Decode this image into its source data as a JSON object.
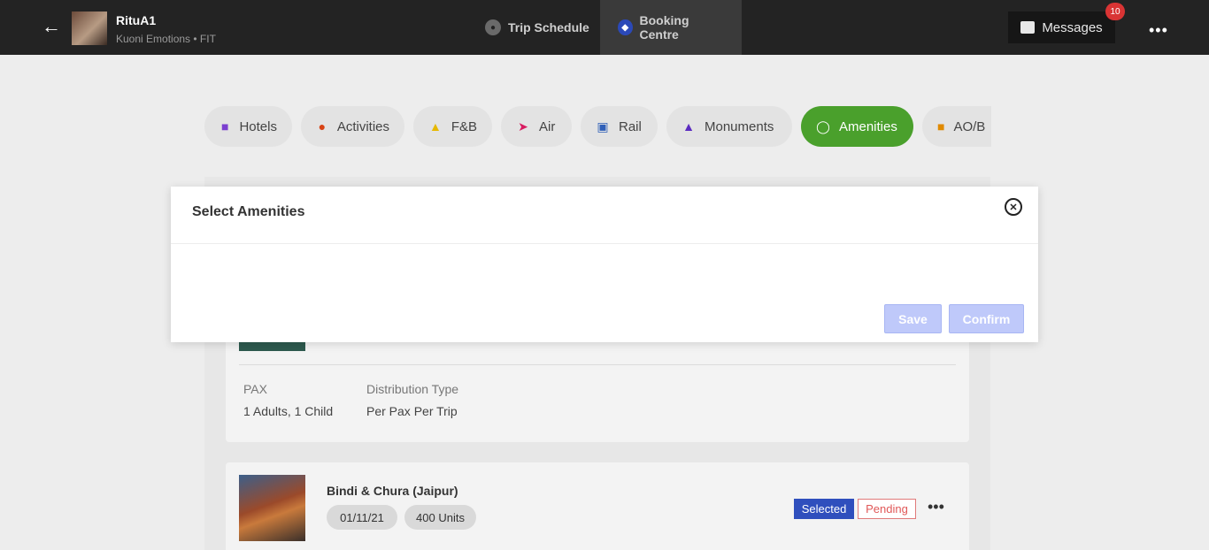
{
  "header": {
    "user_name": "RituA1",
    "user_sub": "Kuoni Emotions • FIT",
    "tabs": [
      {
        "label": "Trip Schedule"
      },
      {
        "label": "Booking Centre"
      }
    ],
    "messages_label": "Messages",
    "messages_count": "10"
  },
  "categories": [
    {
      "label": "Hotels",
      "icon": "bed-icon"
    },
    {
      "label": "Activities",
      "icon": "activity-icon"
    },
    {
      "label": "F&B",
      "icon": "bell-icon"
    },
    {
      "label": "Air",
      "icon": "plane-icon"
    },
    {
      "label": "Rail",
      "icon": "train-icon"
    },
    {
      "label": "Monuments",
      "icon": "monument-icon"
    },
    {
      "label": "Amenities",
      "icon": "basket-icon"
    },
    {
      "label": "AO/B",
      "icon": "car-icon"
    }
  ],
  "card1": {
    "pax_label": "PAX",
    "pax_value": "1 Adults, 1 Child",
    "dist_label": "Distribution Type",
    "dist_value": "Per Pax Per Trip"
  },
  "card2": {
    "title": "Bindi & Chura (Jaipur)",
    "date": "01/11/21",
    "units": "400 Units",
    "selected": "Selected",
    "status": "Pending"
  },
  "modal": {
    "title": "Select Amenities",
    "save_label": "Save",
    "confirm_label": "Confirm"
  },
  "colors": {
    "active_pill": "#4aa02c",
    "button_disabled": "#bfc9fa",
    "selected_badge": "#2f4fbd"
  }
}
